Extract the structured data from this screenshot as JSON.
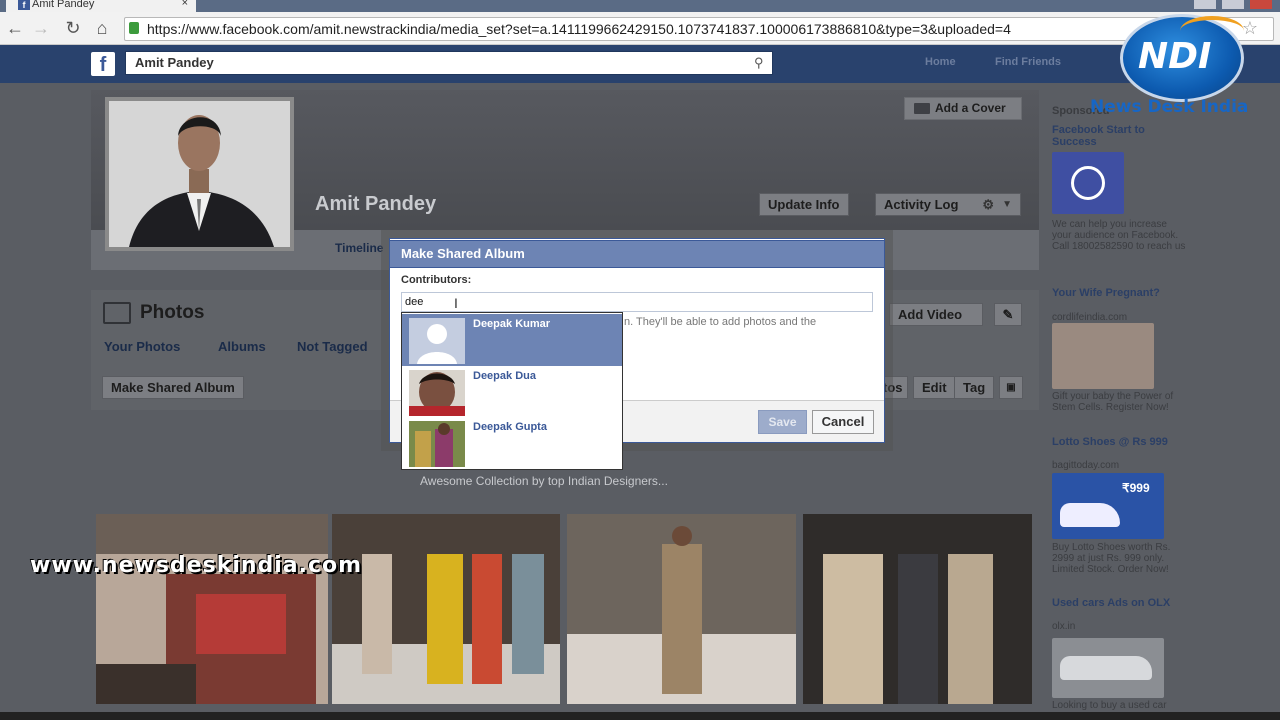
{
  "browser": {
    "tab_title": "Amit Pandey",
    "tab_close": "×",
    "url": "https://www.facebook.com/amit.newstrackindia/media_set?set=a.1411199662429150.1073741837.100006173886810&type=3&uploaded=4",
    "back_icon": "←",
    "forward_icon": "→",
    "reload_icon": "↻",
    "home_icon": "⌂",
    "star_icon": "☆"
  },
  "facebook": {
    "logo_glyph": "f",
    "search_value": "Amit Pandey",
    "search_icon": "⚲",
    "nav": [
      "Home",
      "Find Friends"
    ]
  },
  "profile": {
    "name": "Amit Pandey",
    "add_cover": "Add a Cover",
    "update_info": "Update Info",
    "activity_log": "Activity Log",
    "timeline_tab": "Timeline"
  },
  "photos": {
    "title": "Photos",
    "tabs": [
      "Your Photos",
      "Albums",
      "Not Tagged"
    ],
    "make_shared_album": "Make Shared Album",
    "add_video": "Add Video",
    "photos_btn": "tos",
    "edit_btn": "Edit",
    "tag_btn": "Tag",
    "caption": "Awesome Collection by top Indian Designers..."
  },
  "dialog": {
    "title": "Make Shared Album",
    "contributors_label": "Contributors:",
    "contributors_value": "dee",
    "hint": "n. They'll be able to add photos and the",
    "save": "Save",
    "cancel": "Cancel",
    "suggestions": [
      {
        "name": "Deepak Kumar",
        "highlighted": true
      },
      {
        "name": "Deepak Dua",
        "highlighted": false
      },
      {
        "name": "Deepak Gupta",
        "highlighted": false
      }
    ]
  },
  "sidebar": {
    "sponsored": "Sponsored",
    "ads": [
      {
        "title": "Facebook Start to Success",
        "text": "We can help you increase your audience on Facebook. Call 18002582590 to reach us"
      },
      {
        "title": "Your Wife Pregnant?",
        "subtitle": "cordlifeindia.com",
        "text": "Gift your baby the Power of Stem Cells. Register Now!"
      },
      {
        "title": "Lotto Shoes @ Rs 999",
        "subtitle": "bagittoday.com",
        "text": "Buy Lotto Shoes worth Rs. 2999 at just Rs. 999 only. Limited Stock. Order Now!",
        "price": "₹999"
      },
      {
        "title": "Used cars Ads on OLX",
        "subtitle": "olx.in",
        "text": "Looking to buy a used car"
      }
    ]
  },
  "watermark": {
    "logo_text": "NDI",
    "brand": "News Desk India",
    "url": "www.newsdeskindia.com"
  }
}
